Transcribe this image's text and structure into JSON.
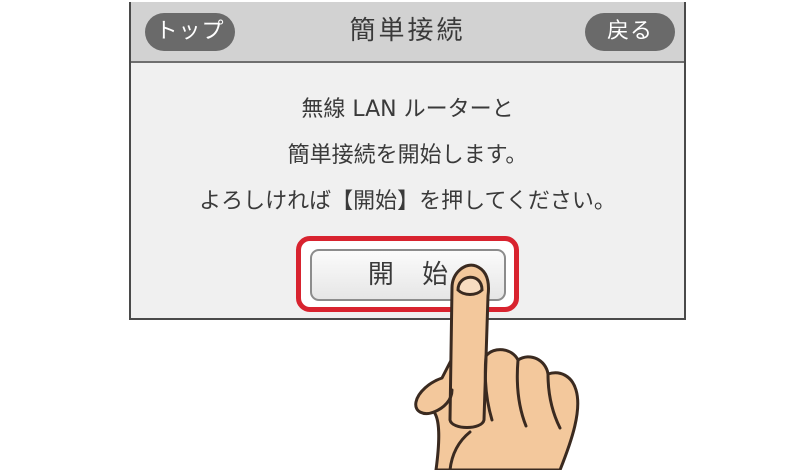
{
  "header": {
    "top_button": "トップ",
    "title": "簡単接続",
    "back_button": "戻る"
  },
  "message": {
    "line1": "無線 LAN ルーターと",
    "line2": "簡単接続を開始します。",
    "line3": "よろしければ【開始】を押してください。"
  },
  "start_button": "開 始",
  "colors": {
    "highlight": "#d8232f",
    "header_bg": "#d2d2d2",
    "screen_bg": "#f0f0f0",
    "pill": "#6a6a6a",
    "skin": "#f3c89c"
  },
  "icons": {
    "pointer": "pointing-hand-icon"
  }
}
